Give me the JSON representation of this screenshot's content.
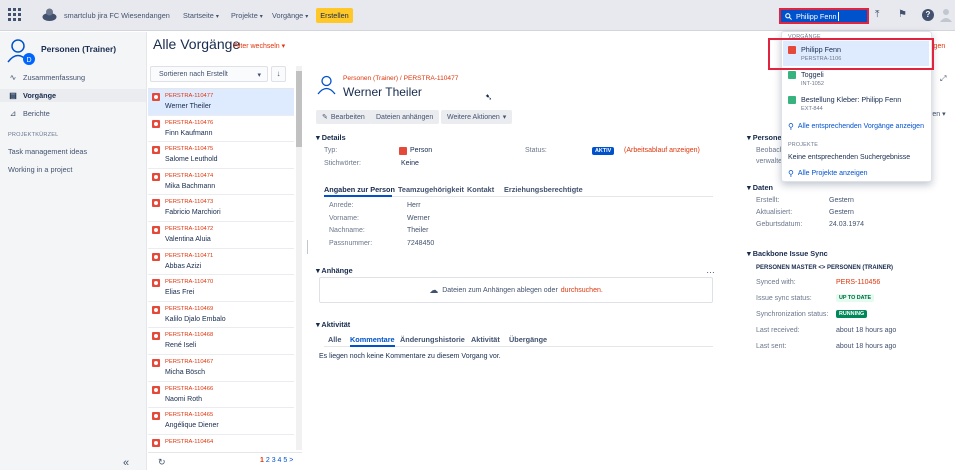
{
  "topbar": {
    "app_title": "smartclub jira FC Wiesendangen",
    "nav": [
      "Startseite",
      "Projekte",
      "Vorgänge"
    ],
    "create_label": "Erstellen",
    "search_value": "Philipp Fenn"
  },
  "sidebar": {
    "project_name": "Personen (Trainer)",
    "items": [
      {
        "label": "Zusammenfassung",
        "icon": "pulse-icon"
      },
      {
        "label": "Vorgänge",
        "icon": "issues-icon"
      },
      {
        "label": "Berichte",
        "icon": "chart-icon"
      }
    ],
    "section_label": "PROJEKTKÜRZEL",
    "links": [
      "Task management ideas",
      "Working in a project"
    ]
  },
  "list": {
    "title": "Alle Vorgänge",
    "filter_label": "Filter wechseln",
    "sort_label": "Sortieren nach Erstellt",
    "rows": [
      {
        "key": "PERSTRA-110477",
        "summary": "Werner Theiler"
      },
      {
        "key": "PERSTRA-110476",
        "summary": "Finn Kaufmann"
      },
      {
        "key": "PERSTRA-110475",
        "summary": "Salome Leuthold"
      },
      {
        "key": "PERSTRA-110474",
        "summary": "Mika Bachmann"
      },
      {
        "key": "PERSTRA-110473",
        "summary": "Fabricio Marchiori"
      },
      {
        "key": "PERSTRA-110472",
        "summary": "Valentina Aluia"
      },
      {
        "key": "PERSTRA-110471",
        "summary": "Abbas Azizi"
      },
      {
        "key": "PERSTRA-110470",
        "summary": "Elias Frei"
      },
      {
        "key": "PERSTRA-110469",
        "summary": "Kalilo Djalo Embalo"
      },
      {
        "key": "PERSTRA-110468",
        "summary": "René Iseli"
      },
      {
        "key": "PERSTRA-110467",
        "summary": "Micha Bösch"
      },
      {
        "key": "PERSTRA-110466",
        "summary": "Naomi Roth"
      },
      {
        "key": "PERSTRA-110465",
        "summary": "Angélique Diener"
      },
      {
        "key": "PERSTRA-110464",
        "summary": ""
      }
    ],
    "pager": {
      "current": "1",
      "others": "2 3 4 5 >"
    }
  },
  "issue": {
    "breadcrumb": "Personen (Trainer) / PERSTRA-110477",
    "title": "Werner Theiler",
    "buttons": [
      "Bearbeiten",
      "Dateien anhängen",
      "Weitere Aktionen"
    ],
    "details": {
      "heading": "Details",
      "type_label": "Typ:",
      "type_value": "Person",
      "status_label": "Status:",
      "status_badge": "AKTIV",
      "status_workflow": "(Arbeitsablauf anzeigen)",
      "keywords_label": "Stichwörter:",
      "keywords_value": "Keine"
    },
    "tabs": [
      "Angaben zur Person",
      "Teamzugehörigkeit",
      "Kontakt",
      "Erziehungsberechtigte"
    ],
    "fields": [
      {
        "label": "Anrede:",
        "value": "Herr"
      },
      {
        "label": "Vorname:",
        "value": "Werner"
      },
      {
        "label": "Nachname:",
        "value": "Theiler"
      },
      {
        "label": "Passnummer:",
        "value": "7248450"
      }
    ],
    "attachments": {
      "heading": "Anhänge",
      "drop_text": "Dateien zum Anhängen ablegen oder",
      "browse_link": "durchsuchen."
    },
    "activity": {
      "heading": "Aktivität",
      "tabs": [
        "Alle",
        "Kommentare",
        "Änderungshistorie",
        "Aktivität",
        "Übergänge"
      ],
      "empty_text": "Es liegen noch keine Kommentare zu diesem Vorgang vor."
    }
  },
  "right_panel": {
    "people_heading": "Persone",
    "people_lines": [
      "Beobach",
      "verwalte"
    ],
    "dates_heading": "Daten",
    "dates": [
      {
        "label": "Erstellt:",
        "value": "Gestern"
      },
      {
        "label": "Aktualisiert:",
        "value": "Gestern"
      },
      {
        "label": "Geburtsdatum:",
        "value": "24.03.1974"
      }
    ],
    "sync_heading": "Backbone Issue Sync",
    "sync_subheading": "PERSONEN MASTER <> PERSONEN (TRAINER)",
    "sync": [
      {
        "label": "Synced with:",
        "value": "PERS-110456"
      },
      {
        "label": "Issue sync status:",
        "value": "UP TO DATE"
      },
      {
        "label": "Synchronization status:",
        "value": "RUNNING"
      },
      {
        "label": "Last received:",
        "value": "about 18 hours ago"
      },
      {
        "label": "Last sent:",
        "value": "about 18 hours ago"
      }
    ],
    "partial_link": "igen",
    "partial_btn": "ren"
  },
  "search_dropdown": {
    "issues_heading": "VORGÄNGE",
    "results": [
      {
        "title": "Philipp Fenn",
        "key": "PERSTRA-1106",
        "color": "#e5493a"
      },
      {
        "title": "Toggeli",
        "key": "INT-1052",
        "color": "#36b37e"
      },
      {
        "title": "Bestellung Kleber: Philipp Fenn",
        "key": "EXT-844",
        "color": "#36b37e"
      }
    ],
    "all_issues_link": "Alle entsprechenden Vorgänge anzeigen",
    "projects_heading": "PROJEKTE",
    "no_results": "Keine entsprechenden Suchergebnisse",
    "all_projects_link": "Alle Projekte anzeigen"
  },
  "colors": {
    "accent": "#0052cc",
    "brand_red": "#de350b",
    "highlight": "#e0243f",
    "create": "#ffc727"
  }
}
